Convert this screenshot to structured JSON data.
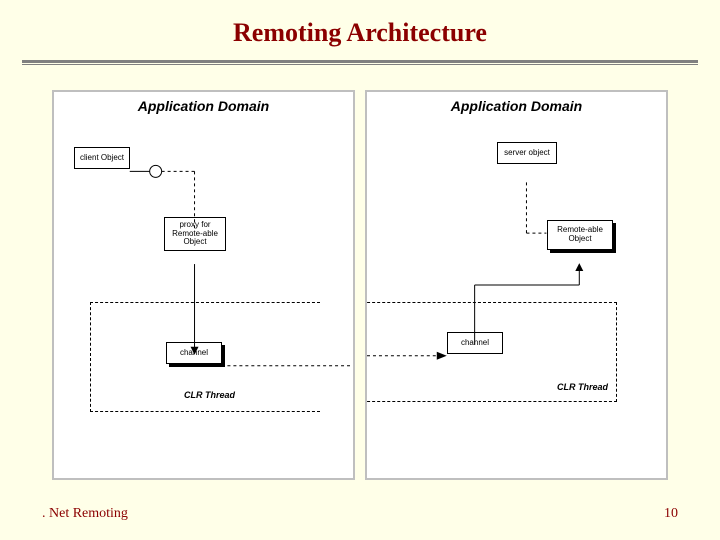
{
  "title": "Remoting Architecture",
  "footer": {
    "left": ". Net Remoting",
    "page": "10"
  },
  "left_panel": {
    "title": "Application Domain",
    "client_object": "client Object",
    "proxy": "proxy for\nRemote-able\nObject",
    "channel": "channel",
    "clr_thread": "CLR Thread"
  },
  "right_panel": {
    "title": "Application Domain",
    "server_object": "server object",
    "remote_object": "Remote-able\nObject",
    "channel": "channel",
    "clr_thread": "CLR Thread"
  }
}
